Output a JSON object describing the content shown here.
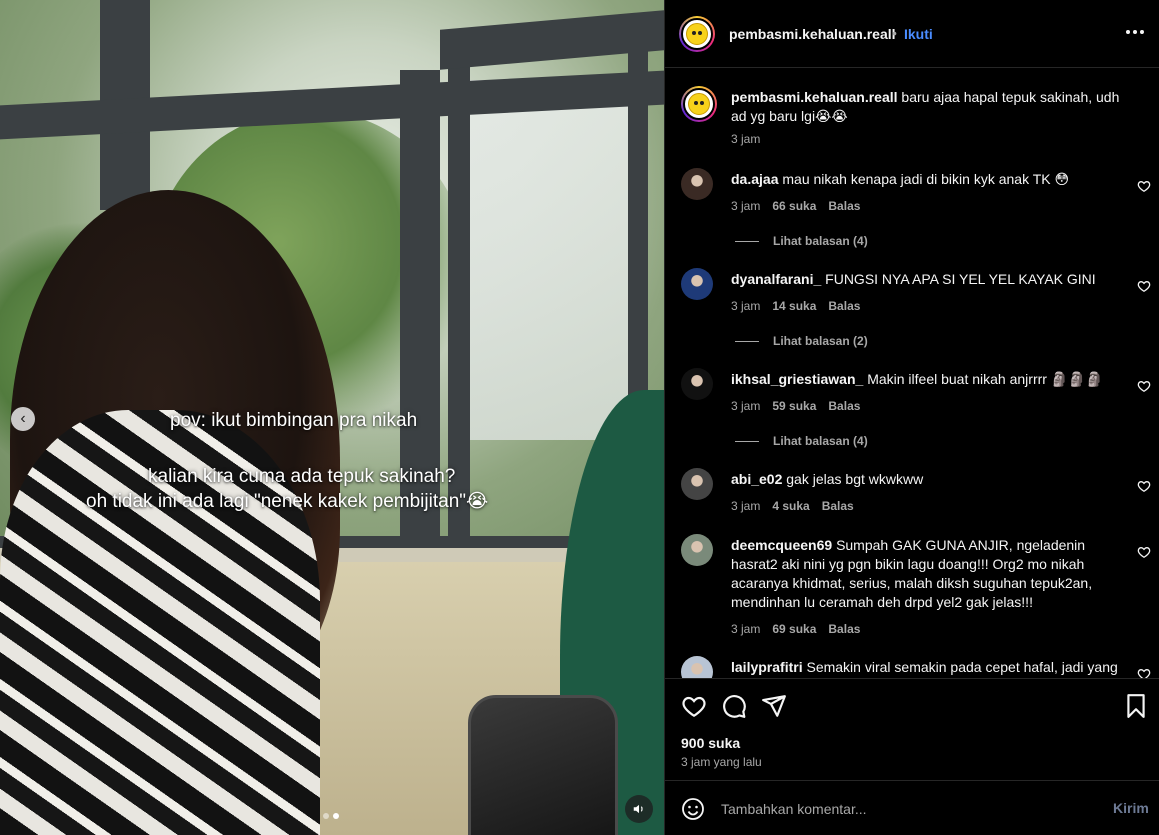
{
  "post": {
    "username": "pembasmi.kehaluan.reall",
    "follow_label": "Ikuti",
    "bullet": "•",
    "caption": {
      "username": "pembasmi.kehaluan.reall",
      "text": "baru ajaa hapal tepuk sakinah, udh ad yg baru lgi😭😭",
      "time": "3 jam"
    },
    "likes": "900 suka",
    "posted": "3 jam yang lalu",
    "comment_placeholder": "Tambahkan komentar...",
    "post_label": "Kirim"
  },
  "media": {
    "overlay_lines": [
      "pov: ikut bimbingan pra nikah",
      "kalian kira cuma ada tepuk sakinah?",
      "oh tidak ini ada lagi \"nenek kakek pembijitan\"😭"
    ],
    "prev_arrow": "‹",
    "slide_count": 2,
    "active_slide": 2
  },
  "comments": [
    {
      "username": "da.ajaa",
      "text": "mau nikah kenapa jadi di bikin kyk anak TK 😳",
      "time": "3 jam",
      "likes": "66 suka",
      "reply": "Balas",
      "view_replies": "Lihat balasan (4)",
      "avatar_color": "#3a2a24"
    },
    {
      "username": "dyanalfarani_",
      "text": "FUNGSI NYA APA SI YEL YEL KAYAK GINI",
      "time": "3 jam",
      "likes": "14 suka",
      "reply": "Balas",
      "view_replies": "Lihat balasan (2)",
      "avatar_color": "#1e3a78"
    },
    {
      "username": "ikhsal_griestiawan_",
      "text": "Makin ilfeel buat nikah anjrrrr 🗿🗿🗿",
      "time": "3 jam",
      "likes": "59 suka",
      "reply": "Balas",
      "view_replies": "Lihat balasan (4)",
      "avatar_color": "#111111"
    },
    {
      "username": "abi_e02",
      "text": "gak jelas bgt wkwkww",
      "time": "3 jam",
      "likes": "4 suka",
      "reply": "Balas",
      "view_replies": "",
      "avatar_color": "#444444"
    },
    {
      "username": "deemcqueen69",
      "text": "Sumpah GAK GUNA ANJIR, ngeladenin hasrat2 aki nini yg pgn bikin lagu doang!!! Org2 mo nikah acaranya khidmat, serius, malah diksh suguhan tepuk2an, mendinhan lu ceramah deh drpd yel2 gak jelas!!!",
      "time": "3 jam",
      "likes": "69 suka",
      "reply": "Balas",
      "view_replies": "",
      "avatar_color": "#7a8a7a"
    },
    {
      "username": "lailyprafitri",
      "text": "Semakin viral semakin pada cepet hafal, jadi yang",
      "time": "",
      "likes": "",
      "reply": "",
      "view_replies": "",
      "avatar_color": "#b8c4d4"
    }
  ],
  "colors": {
    "accent": "#4a8cff",
    "muted": "#a8a8a8",
    "border": "#262626"
  }
}
